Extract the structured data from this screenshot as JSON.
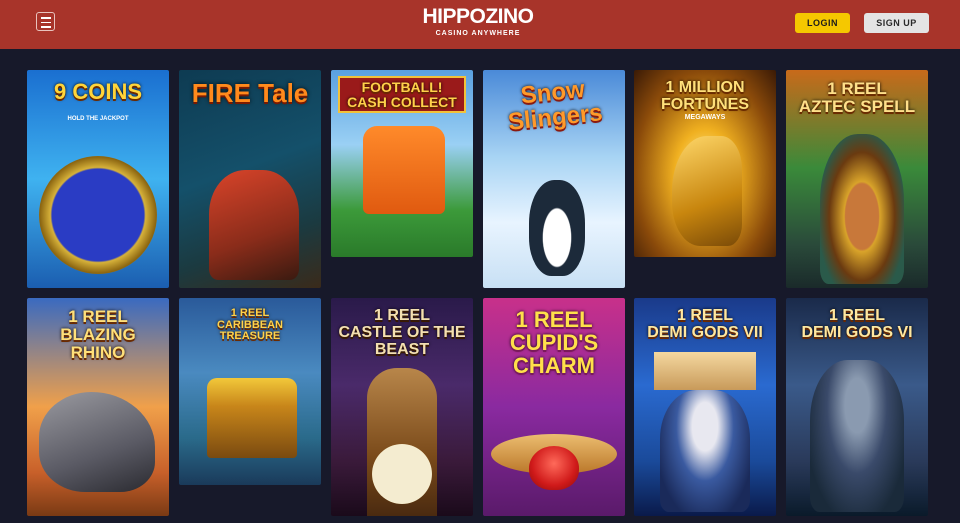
{
  "header": {
    "logo_text": "HIPPOZINO",
    "tagline": "CASINO ANYWHERE",
    "login_label": "LOGIN",
    "signup_label": "SIGN UP"
  },
  "colors": {
    "header_bg": "#a8342a",
    "page_bg": "#17192a",
    "login_bg": "#f5c800",
    "signup_bg": "#e4e4e4"
  },
  "games": [
    {
      "title": "9 COINS",
      "subtitle": "HOLD THE JACKPOT"
    },
    {
      "title": "FIRE Tale"
    },
    {
      "title": "FOOTBALL!\nCASH COLLECT"
    },
    {
      "title": "Snow Slingers"
    },
    {
      "title": "1 MILLION\nFORTUNES",
      "subtitle": "MEGAWAYS"
    },
    {
      "title": "1 REEL\nAZTEC SPELL"
    },
    {
      "title": "1 REEL\nBLAZING RHINO"
    },
    {
      "title": "1 REEL\nCARIBBEAN TREASURE"
    },
    {
      "title": "1 REEL\nCASTLE OF THE BEAST"
    },
    {
      "title": "1 REEL\nCUPID'S\nCHARM"
    },
    {
      "title": "1 REEL\nDEMI GODS VII"
    },
    {
      "title": "1 REEL\nDEMI GODS VI"
    }
  ]
}
